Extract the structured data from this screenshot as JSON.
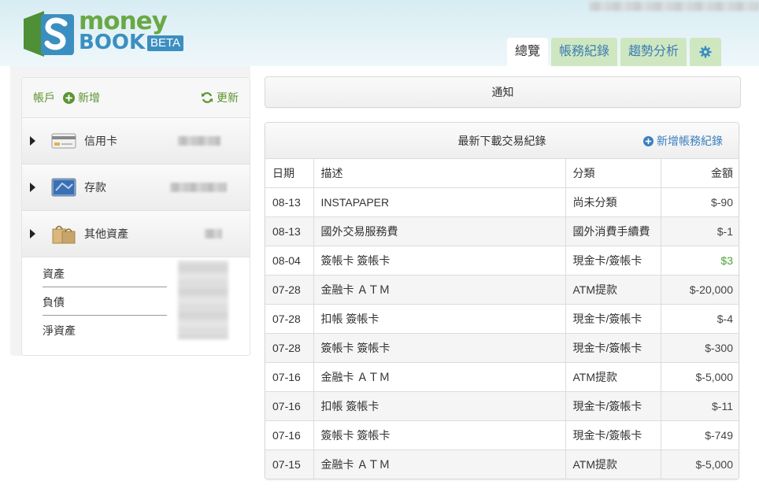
{
  "brand": {
    "money": "money",
    "book": "BOOK",
    "beta": "BETA",
    "accent_green": "#6aa845",
    "accent_blue": "#3b8fc0"
  },
  "tabs": [
    {
      "label": "總覽",
      "active": true
    },
    {
      "label": "帳務紀錄",
      "active": false
    },
    {
      "label": "趨勢分析",
      "active": false
    },
    {
      "label": "",
      "icon": "gear-icon",
      "active": false
    }
  ],
  "accounts": {
    "header": {
      "label": "帳戶",
      "add": "新增",
      "refresh": "更新"
    },
    "items": [
      {
        "label": "信用卡",
        "icon": "credit-card-icon"
      },
      {
        "label": "存款",
        "icon": "bank-card-icon"
      },
      {
        "label": "其他資產",
        "icon": "bags-icon"
      }
    ],
    "summary": [
      {
        "label": "資產"
      },
      {
        "label": "負債"
      },
      {
        "label": "淨資產"
      }
    ]
  },
  "notice": {
    "label": "通知"
  },
  "transactions": {
    "title": "最新下載交易紀錄",
    "add_label": "新增帳務紀錄",
    "columns": [
      "日期",
      "描述",
      "分類",
      "金額"
    ],
    "rows": [
      {
        "date": "08-13",
        "desc": "INSTAPAPER",
        "category": "尚未分類",
        "amount": "$-90",
        "positive": false
      },
      {
        "date": "08-13",
        "desc": "國外交易服務費",
        "category": "國外消費手續費",
        "amount": "$-1",
        "positive": false
      },
      {
        "date": "08-04",
        "desc": "簽帳卡 簽帳卡",
        "category": "現金卡/簽帳卡",
        "amount": "$3",
        "positive": true
      },
      {
        "date": "07-28",
        "desc": "金融卡 ＡＴＭ",
        "category": "ATM提款",
        "amount": "$-20,000",
        "positive": false
      },
      {
        "date": "07-28",
        "desc": "扣帳 簽帳卡",
        "category": "現金卡/簽帳卡",
        "amount": "$-4",
        "positive": false
      },
      {
        "date": "07-28",
        "desc": "簽帳卡 簽帳卡",
        "category": "現金卡/簽帳卡",
        "amount": "$-300",
        "positive": false
      },
      {
        "date": "07-16",
        "desc": "金融卡 ＡＴＭ",
        "category": "ATM提款",
        "amount": "$-5,000",
        "positive": false
      },
      {
        "date": "07-16",
        "desc": "扣帳 簽帳卡",
        "category": "現金卡/簽帳卡",
        "amount": "$-11",
        "positive": false
      },
      {
        "date": "07-16",
        "desc": "簽帳卡 簽帳卡",
        "category": "現金卡/簽帳卡",
        "amount": "$-749",
        "positive": false
      },
      {
        "date": "07-15",
        "desc": "金融卡 ＡＴＭ",
        "category": "ATM提款",
        "amount": "$-5,000",
        "positive": false
      }
    ]
  }
}
